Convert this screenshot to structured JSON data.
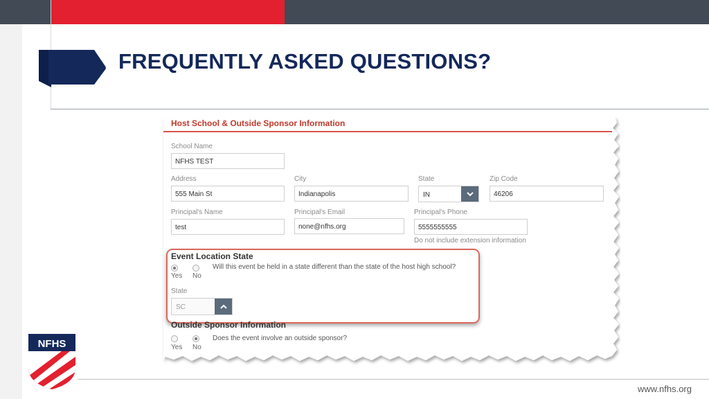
{
  "slide": {
    "title": "FREQUENTLY ASKED QUESTIONS?",
    "footer_url": "www.nfhs.org",
    "logo_text": "NFHS",
    "colors": {
      "navy": "#14285a",
      "red": "#e3202f",
      "topbar": "#424a55"
    }
  },
  "form": {
    "section_title": "Host School & Outside Sponsor Information",
    "school_name": {
      "label": "School Name",
      "value": "NFHS TEST"
    },
    "address": {
      "label": "Address",
      "value": "555 Main St"
    },
    "city": {
      "label": "City",
      "value": "Indianapolis"
    },
    "state": {
      "label": "State",
      "value": "IN",
      "icon": "chevron-down-icon"
    },
    "zip": {
      "label": "Zip Code",
      "value": "46206"
    },
    "principal_name": {
      "label": "Principal's Name",
      "value": "test"
    },
    "principal_email": {
      "label": "Principal's Email",
      "value": "none@nfhs.org"
    },
    "principal_phone": {
      "label": "Principal's Phone",
      "value": "5555555555",
      "hint": "Do not include extension information"
    },
    "event_location": {
      "heading": "Event Location State",
      "question": "Will this event be held in a state different than the state of the host high school?",
      "yes_label": "Yes",
      "no_label": "No",
      "selected": "Yes",
      "state_label": "State",
      "state_value": "SC",
      "state_icon": "chevron-up-icon"
    },
    "outside_sponsor": {
      "heading": "Outside Sponsor Information",
      "question": "Does the event involve an outside sponsor?",
      "yes_label": "Yes",
      "no_label": "No",
      "selected": "No"
    }
  }
}
